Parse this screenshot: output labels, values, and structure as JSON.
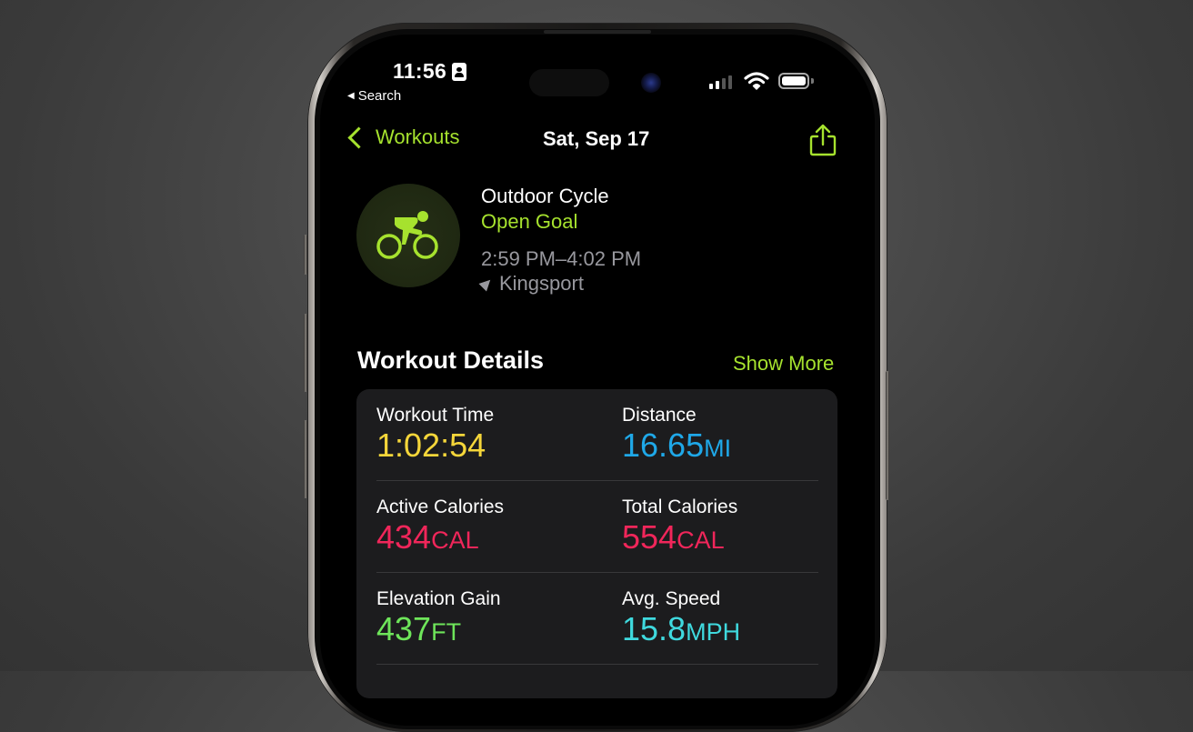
{
  "status_bar": {
    "time": "11:56",
    "back_app": "Search",
    "signal_bars": 2,
    "signal_total": 4,
    "battery_level": "full"
  },
  "nav": {
    "back_label": "Workouts",
    "title": "Sat, Sep 17",
    "share_icon": "share-icon"
  },
  "workout": {
    "icon": "cycling-icon",
    "type": "Outdoor Cycle",
    "goal": "Open Goal",
    "time_range": "2:59 PM–4:02 PM",
    "location": "Kingsport"
  },
  "details": {
    "title": "Workout Details",
    "show_more": "Show More",
    "metrics": [
      {
        "label": "Workout Time",
        "value": "1:02:54",
        "unit": "",
        "color": "#f5d63a"
      },
      {
        "label": "Distance",
        "value": "16.65",
        "unit": "MI",
        "color": "#1fa8e8"
      },
      {
        "label": "Active Calories",
        "value": "434",
        "unit": "CAL",
        "color": "#f0265a"
      },
      {
        "label": "Total Calories",
        "value": "554",
        "unit": "CAL",
        "color": "#f0265a"
      },
      {
        "label": "Elevation Gain",
        "value": "437",
        "unit": "FT",
        "color": "#6ee55a"
      },
      {
        "label": "Avg. Speed",
        "value": "15.8",
        "unit": "MPH",
        "color": "#3fd9de"
      }
    ]
  },
  "colors": {
    "accent": "#a6e22e",
    "secondary_text": "#98989e",
    "card_bg": "#1c1c1e"
  }
}
